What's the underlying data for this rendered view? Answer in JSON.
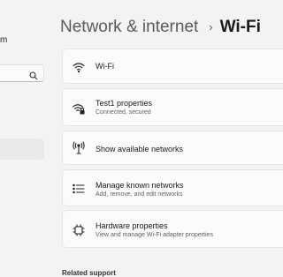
{
  "sidebar": {
    "user_fragment": "m"
  },
  "header": {
    "parent": "Network & internet",
    "separator": "›",
    "current": "Wi-Fi"
  },
  "cards": {
    "wifi": {
      "title": "Wi-Fi",
      "icon": "wifi-icon"
    },
    "properties": {
      "title": "Test1 properties",
      "subtitle": "Connected, secured",
      "icon": "wifi-lock-icon"
    },
    "available": {
      "title": "Show available networks",
      "icon": "antenna-icon"
    },
    "known": {
      "title": "Manage known networks",
      "subtitle": "Add, remove, and edit networks",
      "icon": "list-icon"
    },
    "hardware": {
      "title": "Hardware properties",
      "subtitle": "View and manage Wi-Fi adapter properties",
      "icon": "chip-icon"
    }
  },
  "related": {
    "label": "Related support"
  }
}
